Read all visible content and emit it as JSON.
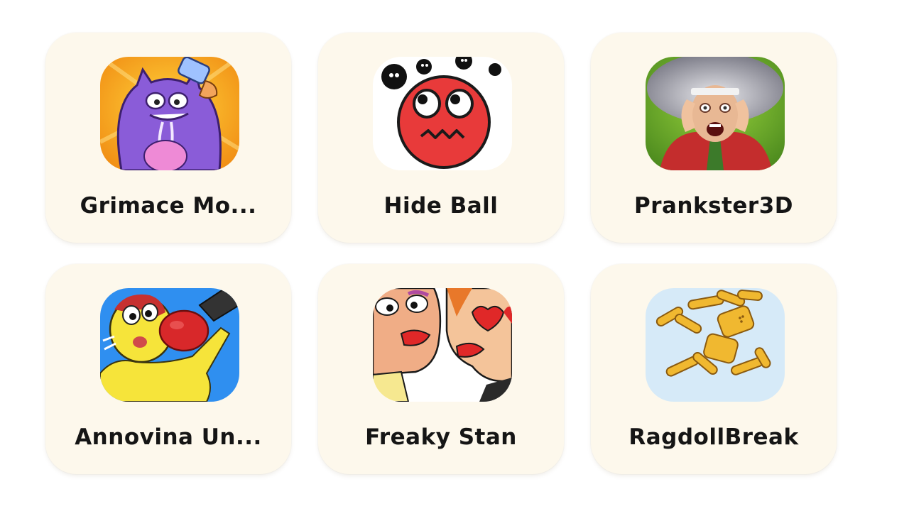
{
  "games": [
    {
      "name": "Grimace Mo...",
      "icon": "grimace-monster-icon"
    },
    {
      "name": "Hide Ball",
      "icon": "red-ball-icon"
    },
    {
      "name": "Prankster3D",
      "icon": "screaming-teacher-icon"
    },
    {
      "name": "Annovina Un...",
      "icon": "boxing-glove-icon"
    },
    {
      "name": "Freaky Stan",
      "icon": "kissing-faces-icon"
    },
    {
      "name": "RagdollBreak",
      "icon": "ragdoll-icon"
    }
  ]
}
